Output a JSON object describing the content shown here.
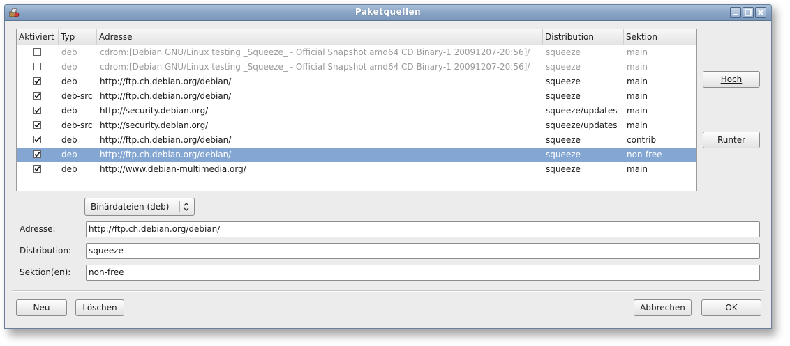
{
  "window": {
    "title": "Paketquellen"
  },
  "table": {
    "columns": [
      "Aktiviert",
      "Typ",
      "Adresse",
      "Distribution",
      "Sektion"
    ],
    "rows": [
      {
        "checked": false,
        "type": "deb",
        "address": "cdrom:[Debian GNU/Linux testing _Squeeze_ - Official Snapshot amd64 CD Binary-1 20091207-20:56]/",
        "distribution": "squeeze",
        "section": "main",
        "state": "disabled"
      },
      {
        "checked": false,
        "type": "deb",
        "address": "cdrom:[Debian GNU/Linux testing _Squeeze_ - Official Snapshot amd64 CD Binary-1 20091207-20:56]/",
        "distribution": "squeeze",
        "section": "main",
        "state": "disabled"
      },
      {
        "checked": true,
        "type": "deb",
        "address": "http://ftp.ch.debian.org/debian/",
        "distribution": "squeeze",
        "section": "main",
        "state": "normal"
      },
      {
        "checked": true,
        "type": "deb-src",
        "address": "http://ftp.ch.debian.org/debian/",
        "distribution": "squeeze",
        "section": "main",
        "state": "normal"
      },
      {
        "checked": true,
        "type": "deb",
        "address": "http://security.debian.org/",
        "distribution": "squeeze/updates",
        "section": "main",
        "state": "normal"
      },
      {
        "checked": true,
        "type": "deb-src",
        "address": "http://security.debian.org/",
        "distribution": "squeeze/updates",
        "section": "main",
        "state": "normal"
      },
      {
        "checked": true,
        "type": "deb",
        "address": "http://ftp.ch.debian.org/debian/",
        "distribution": "squeeze",
        "section": "contrib",
        "state": "normal"
      },
      {
        "checked": true,
        "type": "deb",
        "address": "http://ftp.ch.debian.org/debian/",
        "distribution": "squeeze",
        "section": "non-free",
        "state": "selected"
      },
      {
        "checked": true,
        "type": "deb",
        "address": "http://www.debian-multimedia.org/",
        "distribution": "squeeze",
        "section": "main",
        "state": "normal"
      }
    ]
  },
  "side_buttons": {
    "up": "Hoch",
    "down": "Runter"
  },
  "editor": {
    "type_select": "Binärdateien (deb)",
    "address_label": "Adresse:",
    "address_value": "http://ftp.ch.debian.org/debian/",
    "distribution_label": "Distribution:",
    "distribution_value": "squeeze",
    "sections_label": "Sektion(en):",
    "sections_value": "non-free"
  },
  "footer": {
    "new": "Neu",
    "delete": "Löschen",
    "cancel": "Abbrechen",
    "ok": "OK"
  },
  "colors": {
    "selection": "#84a6d3",
    "titlebar": "#87a3c4"
  },
  "icons": {
    "title_app": "package-sources-icon",
    "minimize": "minimize-icon",
    "maximize": "maximize-icon",
    "close": "close-icon",
    "checkbox": "checkbox-check-icon",
    "combo_arrow": "updown-arrows-icon"
  }
}
